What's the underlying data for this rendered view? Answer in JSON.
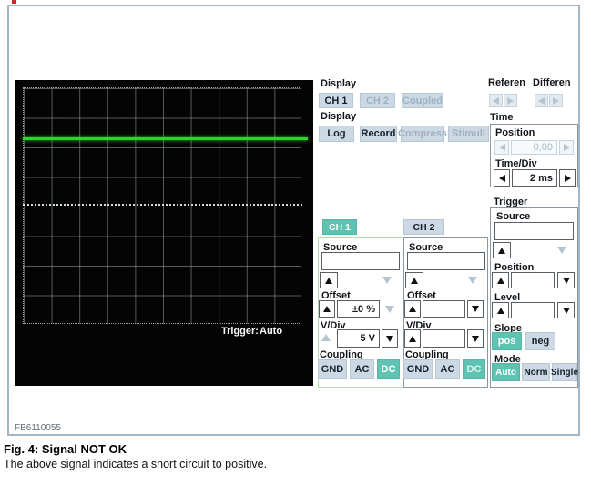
{
  "scope": {
    "trigger_label": "Trigger:",
    "trigger_value": "Auto"
  },
  "display_channels": {
    "label": "Display",
    "ch1": "CH 1",
    "ch2": "CH 2",
    "coupled": "Coupled"
  },
  "display_modes": {
    "label": "Display",
    "log": "Log",
    "record": "Record",
    "compress": "Compress",
    "stimuli": "Stimuli"
  },
  "reference": {
    "label": "Referen"
  },
  "differential": {
    "label": "Differen"
  },
  "time": {
    "label": "Time",
    "position_label": "Position",
    "position_value": "0,00",
    "timediv_label": "Time/Div",
    "timediv_value": "2 ms"
  },
  "trigger": {
    "label": "Trigger",
    "source_label": "Source",
    "source_value": "",
    "position_label": "Position",
    "position_value": "",
    "level_label": "Level",
    "level_value": "",
    "slope_label": "Slope",
    "pos": "pos",
    "neg": "neg",
    "mode_label": "Mode",
    "auto": "Auto",
    "norm": "Norm",
    "single": "Single"
  },
  "ch1": {
    "tab": "CH 1",
    "source_label": "Source",
    "source_value": "",
    "offset_label": "Offset",
    "offset_value": "±0 %",
    "vdiv_label": "V/Div",
    "vdiv_value": "5 V",
    "coupling_label": "Coupling",
    "gnd": "GND",
    "ac": "AC",
    "dc": "DC"
  },
  "ch2": {
    "tab": "CH 2",
    "source_label": "Source",
    "source_value": "",
    "offset_label": "Offset",
    "offset_value": "",
    "vdiv_label": "V/Div",
    "vdiv_value": "",
    "coupling_label": "Coupling",
    "gnd": "GND",
    "ac": "AC",
    "dc": "DC"
  },
  "footer": {
    "figure_code": "FB6110055"
  },
  "caption": {
    "title": "Fig. 4: Signal NOT OK",
    "body": "The above signal indicates a short circuit to positive."
  },
  "colors": {
    "accent_teal": "#5fc3b1",
    "signal_green": "#2fd32f",
    "button_blue": "#ccd9e4",
    "frame_border": "#a2b6c5"
  }
}
